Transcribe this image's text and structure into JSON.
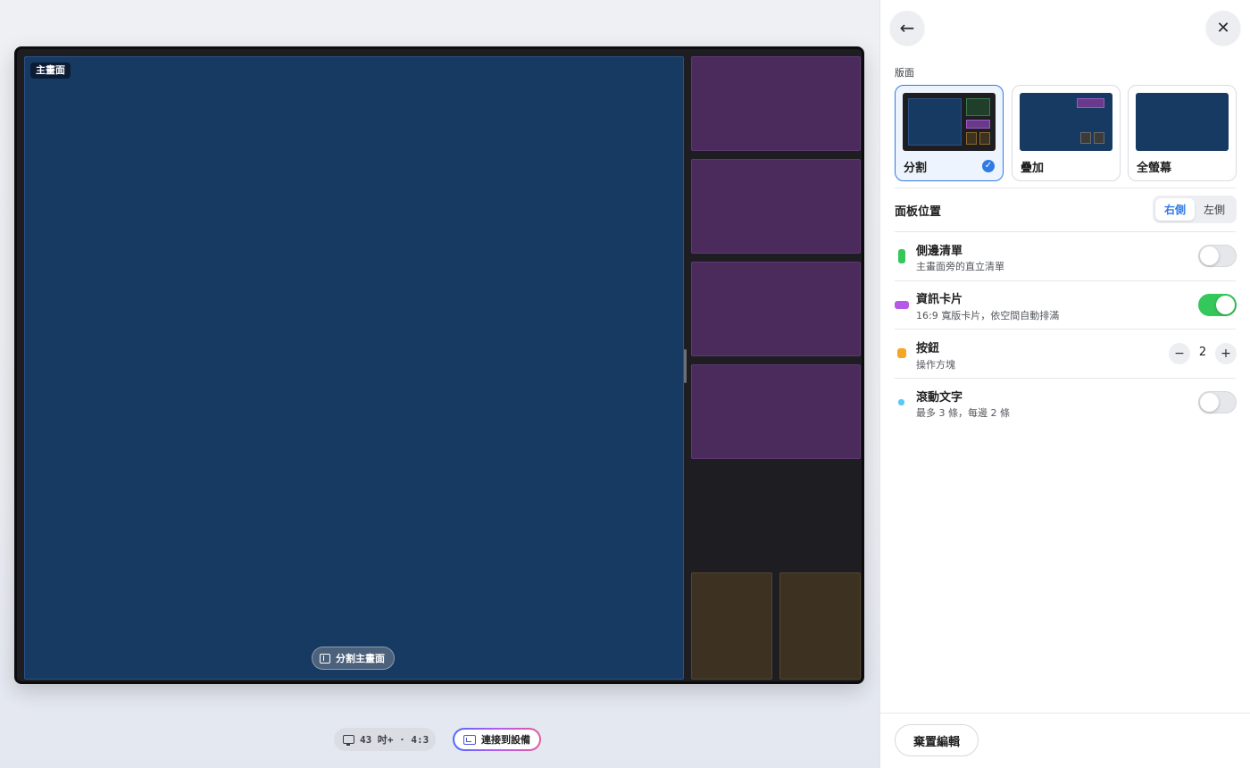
{
  "stage": {
    "main_label": "主畫面",
    "split_button_label": "分割主畫面",
    "screen_size_label": "43 吋+ · 4:3",
    "connect_label": "連接到設備",
    "icons": {
      "split": "split-screen-icon",
      "monitor": "monitor-icon",
      "cast": "cast-icon"
    }
  },
  "panel": {
    "back_icon": "←",
    "close_icon": "✕",
    "layout_section_label": "版面",
    "layouts": [
      {
        "name": "分割",
        "selected": true
      },
      {
        "name": "疊加",
        "selected": false
      },
      {
        "name": "全螢幕",
        "selected": false
      }
    ],
    "position": {
      "label": "面板位置",
      "options": [
        "右側",
        "左側"
      ],
      "selected": "右側"
    },
    "features": [
      {
        "title": "側邊清單",
        "subtitle": "主畫面旁的直立清單",
        "color": "#34c759",
        "control": "toggle",
        "on": false
      },
      {
        "title": "資訊卡片",
        "subtitle": "16:9 寬版卡片，依空間自動排滿",
        "color": "#b55ae8",
        "control": "toggle",
        "on": true
      },
      {
        "title": "按鈕",
        "subtitle": "操作方塊",
        "color": "#f5a623",
        "control": "stepper",
        "value": "2",
        "minus": "−",
        "plus": "+"
      },
      {
        "title": "滾動文字",
        "subtitle": "最多 3 條，每邊 2 條",
        "color": "#5ac8fa",
        "control": "toggle",
        "on": false
      }
    ],
    "discard_label": "棄置編輯"
  }
}
